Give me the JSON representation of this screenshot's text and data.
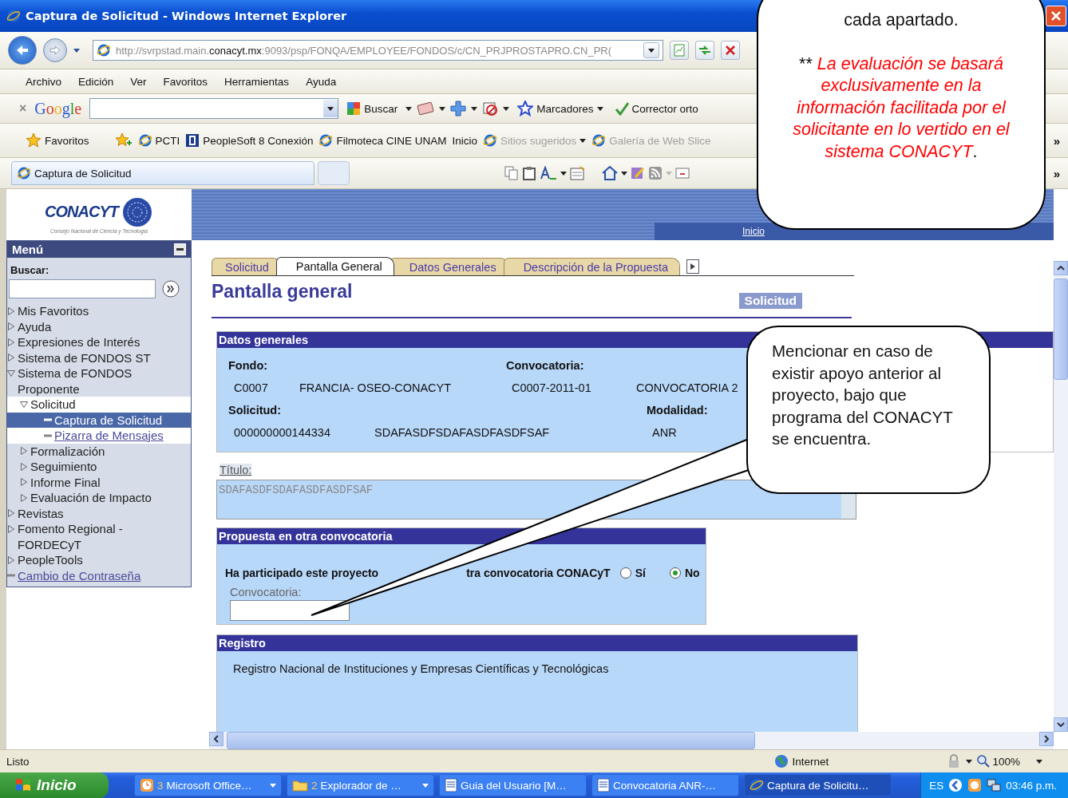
{
  "window": {
    "title": "Captura de Solicitud - Windows Internet Explorer"
  },
  "address": {
    "url_start": "http://svrpstad.main.",
    "url_domain": "conacyt.mx",
    "url_end": ":9093/psp/FONQA/EMPLOYEE/FONDOS/c/CN_PRJPROSTAPRO.CN_PR("
  },
  "menu_bar": [
    "Archivo",
    "Edición",
    "Ver",
    "Favoritos",
    "Herramientas",
    "Ayuda"
  ],
  "google_bar": {
    "close": "×",
    "logo": "Google",
    "search_button": "Buscar",
    "bookmarks": "Marcadores",
    "spellcheck": "Corrector orto"
  },
  "favorites_bar": {
    "favorites": "Favoritos",
    "overflow": "»",
    "links": [
      {
        "label": "PCTI",
        "kind": "page",
        "dimmed": false,
        "menu": false
      },
      {
        "label": "PeopleSoft 8 Conexión",
        "kind": "app",
        "dimmed": false,
        "menu": false
      },
      {
        "label": "Filmoteca CINE UNAM",
        "kind": "page",
        "dimmed": false,
        "menu": false
      },
      {
        "label": "Inicio",
        "kind": "plain",
        "dimmed": false,
        "menu": false
      },
      {
        "label": "Sitios sugeridos",
        "kind": "browser",
        "dimmed": true,
        "menu": true
      },
      {
        "label": "Galería de Web Slice",
        "kind": "page",
        "dimmed": true,
        "menu": false
      }
    ]
  },
  "browser_tab": {
    "label": "Captura de Solicitud",
    "overflow": "»"
  },
  "logo": {
    "name": "CONACYT",
    "subtitle": "Consejo Nacional de Ciencia y Tecnología"
  },
  "banner": {
    "links": [
      "Inicio"
    ]
  },
  "sidebar": {
    "title": "Menú",
    "search_label": "Buscar:",
    "items": [
      {
        "label": "Mis Favoritos",
        "kind": "folder",
        "expanded": false,
        "selected": false
      },
      {
        "label": "Ayuda",
        "kind": "folder",
        "expanded": false,
        "selected": false
      },
      {
        "label": "Expresiones de Interés",
        "kind": "folder",
        "expanded": false,
        "selected": false
      },
      {
        "label": "Sistema de FONDOS ST",
        "kind": "folder",
        "expanded": false,
        "selected": false
      },
      {
        "label": "Sistema de FONDOS Proponente",
        "kind": "folder",
        "expanded": true,
        "selected": false,
        "children": [
          {
            "label": "Solicitud",
            "kind": "folder",
            "expanded": true,
            "selected": false,
            "children": [
              {
                "label": "Captura de Solicitud",
                "kind": "link",
                "selected": true
              },
              {
                "label": "Pizarra de Mensajes",
                "kind": "link",
                "selected": false
              }
            ]
          },
          {
            "label": "Formalización",
            "kind": "folder",
            "expanded": false,
            "selected": false
          },
          {
            "label": "Seguimiento",
            "kind": "folder",
            "expanded": false,
            "selected": false
          },
          {
            "label": "Informe Final",
            "kind": "folder",
            "expanded": false,
            "selected": false
          },
          {
            "label": "Evaluación de Impacto",
            "kind": "folder",
            "expanded": false,
            "selected": false
          }
        ]
      },
      {
        "label": "Revistas",
        "kind": "folder",
        "expanded": false,
        "selected": false
      },
      {
        "label": "Fomento Regional - FORDECyT",
        "kind": "folder",
        "expanded": false,
        "selected": false
      },
      {
        "label": "PeopleTools",
        "kind": "folder",
        "expanded": false,
        "selected": false
      },
      {
        "label": "Cambio de Contraseña",
        "kind": "link",
        "selected": false
      }
    ]
  },
  "page_tabs": [
    {
      "label": "Solicitud",
      "selected": false
    },
    {
      "label": "Pantalla General",
      "selected": true
    },
    {
      "label": "Datos Generales",
      "selected": false
    },
    {
      "label": "Descripción de la Propuesta",
      "selected": false
    }
  ],
  "page_title": "Pantalla general",
  "badge": "Solicitud",
  "general_data": {
    "title": "Datos generales",
    "fondo_label": "Fondo:",
    "fondo_code": "C0007",
    "fondo_name": "FRANCIA- OSEO-CONACYT",
    "call_label": "Convocatoria:",
    "call_code": "C0007-2011-01",
    "call_name": "CONVOCATORIA 2",
    "request_label": "Solicitud:",
    "request_number": "000000000144334",
    "request_name": "SDAFASDFSDAFASDFASDFSAF",
    "mode_label": "Modalidad:",
    "mode_value": "ANR"
  },
  "title_field": {
    "label": "Título:",
    "value": "SDAFASDFSDAFASDFASDFSAF"
  },
  "other_call": {
    "title": "Propuesta en otra convocatoria",
    "question_start": "Ha participado este proyecto",
    "question_end": "tra convocatoria CONACyT",
    "options": [
      {
        "label": "Sí",
        "selected": false
      },
      {
        "label": "No",
        "selected": true
      }
    ],
    "field_label": "Convocatoria:"
  },
  "registry": {
    "title": "Registro",
    "text": "Registro Nacional de Instituciones y Empresas Científicas y Tecnológicas"
  },
  "status_bar": {
    "text": "Listo",
    "zone": "Internet",
    "zoom": "100%"
  },
  "taskbar": {
    "start": "Inicio",
    "tasks": [
      {
        "count": "3",
        "label": "Microsoft Office…",
        "kind": "group",
        "selected": false
      },
      {
        "count": "2",
        "label": "Explorador de …",
        "kind": "folder",
        "selected": false
      },
      {
        "label": "Guia del Usuario [M…",
        "kind": "document",
        "selected": false
      },
      {
        "label": "Convocatoria ANR-…",
        "kind": "document",
        "selected": false
      },
      {
        "label": "Captura de Solicitu…",
        "kind": "browser",
        "selected": true
      }
    ],
    "language": "ES",
    "clock": "03:46 p.m."
  },
  "callouts": [
    {
      "text": "cada apartado.",
      "prefix": "**",
      "note": "La evaluación se basará exclusivamente en la información facilitada por el solicitante en lo vertido en el sistema CONACYT",
      "end": "."
    },
    {
      "text": "Mencionar en caso de existir apoyo anterior al proyecto, bajo que programa del CONACYT se encuentra."
    }
  ]
}
